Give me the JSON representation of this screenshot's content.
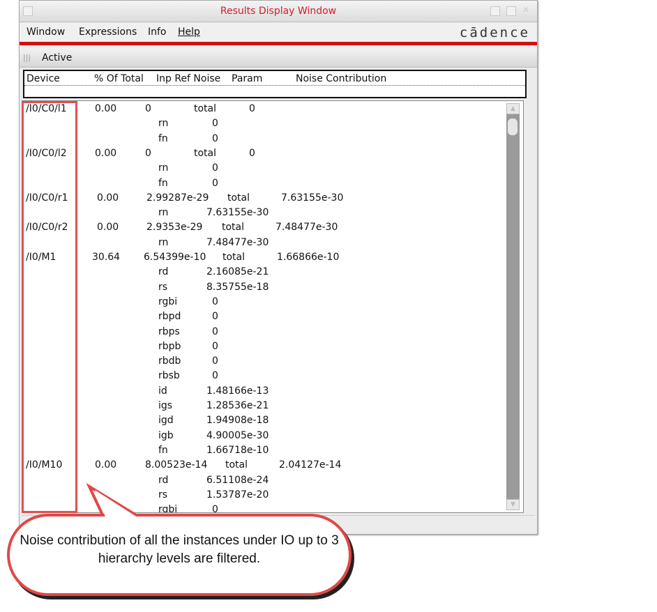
{
  "window": {
    "title": "Results Display Window",
    "logo": "cādence"
  },
  "menu": [
    "Window",
    "Expressions",
    "Info",
    "Help"
  ],
  "toolbar": {
    "label": "Active"
  },
  "columns": [
    "Device",
    "% Of Total",
    "Inp Ref Noise",
    "Param",
    "Noise Contribution"
  ],
  "rows": [
    [
      "/I0/C0/l1",
      "0.00",
      "0",
      "total",
      "0"
    ],
    [
      "",
      "",
      "",
      "rn",
      "0"
    ],
    [
      "",
      "",
      "",
      "fn",
      "0"
    ],
    [
      "/I0/C0/l2",
      "0.00",
      "0",
      "total",
      "0"
    ],
    [
      "",
      "",
      "",
      "rn",
      "0"
    ],
    [
      "",
      "",
      "",
      "fn",
      "0"
    ],
    [
      "/I0/C0/r1",
      "0.00",
      "2.99287e-29",
      "total",
      "7.63155e-30"
    ],
    [
      "",
      "",
      "",
      "rn",
      "7.63155e-30"
    ],
    [
      "/I0/C0/r2",
      "0.00",
      "2.9353e-29",
      "total",
      "7.48477e-30"
    ],
    [
      "",
      "",
      "",
      "rn",
      "7.48477e-30"
    ],
    [
      "/I0/M1",
      "30.64",
      "6.54399e-10",
      "total",
      "1.66866e-10"
    ],
    [
      "",
      "",
      "",
      "rd",
      "2.16085e-21"
    ],
    [
      "",
      "",
      "",
      "rs",
      "8.35755e-18"
    ],
    [
      "",
      "",
      "",
      "rgbi",
      "0"
    ],
    [
      "",
      "",
      "",
      "rbpd",
      "0"
    ],
    [
      "",
      "",
      "",
      "rbps",
      "0"
    ],
    [
      "",
      "",
      "",
      "rbpb",
      "0"
    ],
    [
      "",
      "",
      "",
      "rbdb",
      "0"
    ],
    [
      "",
      "",
      "",
      "rbsb",
      "0"
    ],
    [
      "",
      "",
      "",
      "id",
      "1.48166e-13"
    ],
    [
      "",
      "",
      "",
      "igs",
      "1.28536e-21"
    ],
    [
      "",
      "",
      "",
      "igd",
      "1.94908e-18"
    ],
    [
      "",
      "",
      "",
      "igb",
      "4.90005e-30"
    ],
    [
      "",
      "",
      "",
      "fn",
      "1.66718e-10"
    ],
    [
      "/I0/M10",
      "0.00",
      "8.00523e-14",
      "total",
      "2.04127e-14"
    ],
    [
      "",
      "",
      "",
      "rd",
      "6.51108e-24"
    ],
    [
      "",
      "",
      "",
      "rs",
      "1.53787e-20"
    ],
    [
      "",
      "",
      "",
      "rgbi",
      "0"
    ]
  ],
  "callout": {
    "text": "Noise contribution of all the instances under IO up to 3 hierarchy levels are filtered."
  },
  "colors": {
    "accent": "#d01010",
    "highlight": "#e04848"
  }
}
